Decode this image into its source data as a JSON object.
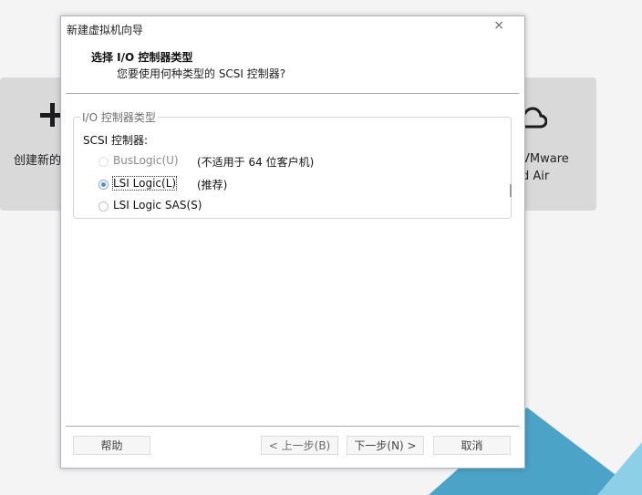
{
  "background_app": {
    "left_card_label": "创建新的",
    "right_card_line1": "VMware",
    "right_card_line2": "d Air"
  },
  "dialog": {
    "title": "新建虚拟机向导",
    "close_symbol": "×",
    "step_title": "选择 I/O 控制器类型",
    "step_description": "您要使用何种类型的 SCSI 控制器?",
    "group_title": "I/O 控制器类型",
    "scsi_label": "SCSI 控制器:",
    "options": [
      {
        "label": "BusLogic(U)",
        "note": "(不适用于 64 位客户机)",
        "selected": false,
        "enabled": false
      },
      {
        "label": "LSI Logic(L)",
        "note": "(推荐)",
        "selected": true,
        "enabled": true
      },
      {
        "label": "LSI Logic SAS(S)",
        "note": "",
        "selected": false,
        "enabled": true
      }
    ],
    "buttons": {
      "help": "帮助",
      "back": "< 上一步(B)",
      "next": "下一步(N) >",
      "cancel": "取消"
    }
  }
}
